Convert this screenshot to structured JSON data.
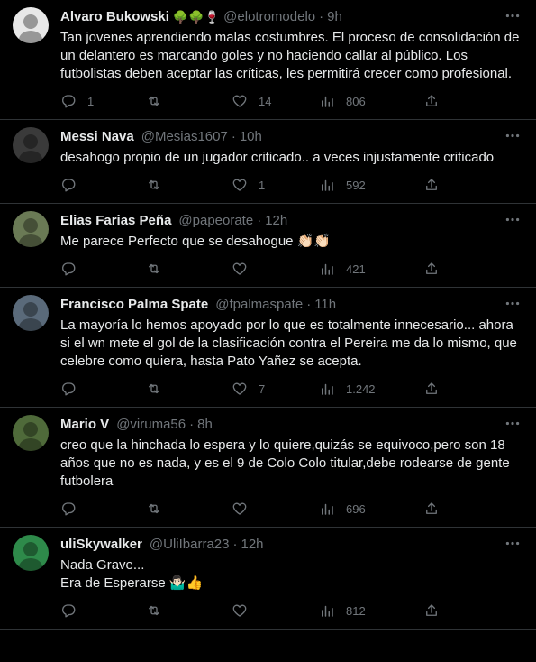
{
  "tweets": [
    {
      "name": "Alvaro Bukowski",
      "emojis": "🌳🌳🍷",
      "handle": "@elotromodelo",
      "dot": "·",
      "time": "9h",
      "text": "Tan jovenes aprendiendo malas costumbres. El proceso de consolidación de un delantero es marcando goles y no haciendo callar al público. Los futbolistas deben aceptar las críticas, les permitirá crecer como profesional.",
      "replies": "1",
      "retweets": "",
      "likes": "14",
      "views": "806",
      "avatar_color": "#e8e8e8"
    },
    {
      "name": "Messi Nava",
      "emojis": "",
      "handle": "@Mesias1607",
      "dot": "·",
      "time": "10h",
      "text": "desahogo propio de un jugador criticado.. a veces injustamente criticado",
      "replies": "",
      "retweets": "",
      "likes": "1",
      "views": "592",
      "avatar_color": "#3a3a3a"
    },
    {
      "name": "Elias Farias Peña",
      "emojis": "",
      "handle": "@papeorate",
      "dot": "·",
      "time": "12h",
      "text": "Me parece Perfecto que se desahogue 👏🏻👏🏻",
      "replies": "",
      "retweets": "",
      "likes": "",
      "views": "421",
      "avatar_color": "#6a7a55"
    },
    {
      "name": "Francisco Palma Spate",
      "emojis": "",
      "handle": "@fpalmaspate",
      "dot": "·",
      "time": "11h",
      "text": "La mayoría lo hemos apoyado por lo que es totalmente innecesario... ahora si el wn mete el gol de la clasificación contra el Pereira me da lo mismo, que celebre como quiera, hasta Pato Yañez se acepta.",
      "replies": "",
      "retweets": "",
      "likes": "7",
      "views": "1.242",
      "avatar_color": "#5a6a7a"
    },
    {
      "name": "Mario V",
      "emojis": "",
      "handle": "@viruma56",
      "dot": "·",
      "time": "8h",
      "text": "creo que la hinchada lo espera y lo quiere,quizás se equivoco,pero son 18 años que no es nada, y es el 9 de Colo Colo titular,debe rodearse de gente futbolera",
      "replies": "",
      "retweets": "",
      "likes": "",
      "views": "696",
      "avatar_color": "#4f6a3a"
    },
    {
      "name": "uliSkywalker",
      "emojis": "",
      "handle": "@UliIbarra23",
      "dot": "·",
      "time": "12h",
      "text": "Nada Grave...\nEra de Esperarse 🤷🏻‍♂️👍",
      "replies": "",
      "retweets": "",
      "likes": "",
      "views": "812",
      "avatar_color": "#2e8a4a"
    }
  ],
  "colors": {
    "background": "#000000",
    "text": "#e7e9ea",
    "secondary": "#71767b",
    "divider": "#2f3336"
  },
  "icons": [
    "more-icon",
    "reply-icon",
    "retweet-icon",
    "like-icon",
    "views-icon",
    "share-icon"
  ]
}
